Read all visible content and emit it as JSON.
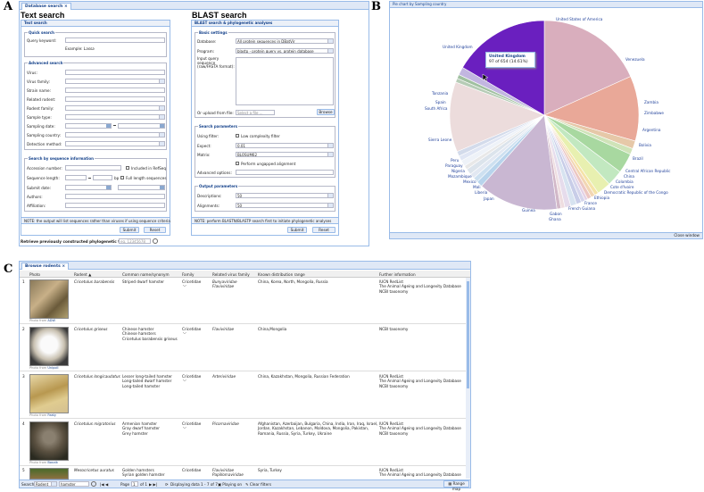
{
  "panel_letters": {
    "a": "A",
    "b": "B",
    "c": "C"
  },
  "panelA": {
    "tab_label": "Database search",
    "text_search": {
      "title": "Text search",
      "subtab": "Text search",
      "quick_legend": "Quick search",
      "query_label": "Query keyword:",
      "example_label": "Example:",
      "example_value": "Lassa",
      "advanced_legend": "Advanced search",
      "fields": [
        "Virus:",
        "Virus family:",
        "Strain name:",
        "Related rodent:",
        "Rodent family:",
        "Sample type:",
        "Sampling date:",
        "Sampling country:",
        "Detection method:"
      ],
      "sequence_legend": "Search by sequence information",
      "accession_label": "Accession number:",
      "refseq_label": "Included in RefSeq",
      "seqlen_label": "Sequence length:",
      "seqlen_unit": "bp",
      "fulllength_label": "Full length sequences",
      "submit_date_label": "Submit date:",
      "authors_label": "Authors:",
      "affiliation_label": "Affiliation:",
      "note": "NOTE: the output will list sequences rather than viruses if using sequence criteria",
      "submit_btn": "Submit",
      "reset_btn": "Reset"
    },
    "retrieve_label": "Retrieve previously constructed phylogenetic tree by ID:",
    "retrieve_value": "eg. 12345678",
    "blast": {
      "title": "BLAST search",
      "subtab": "BLAST search & phylogenetic analyses",
      "basic_legend": "Basic settings",
      "database_label": "Database:",
      "database_value": "All protein sequences in DBatVir",
      "program_label": "Program:",
      "program_value": "blastp - protein query vs. protein database",
      "input_label": "Input query sequence (raw/FASTA format):",
      "upload_label": "Or upload from file:",
      "upload_placeholder": "Select a file ...",
      "browse_btn": "Browse",
      "params_legend": "Search parameters",
      "filter_label": "Using filter:",
      "filter_value": "Low complexity filter",
      "expect_label": "Expect:",
      "expect_value": "0.01",
      "matrix_label": "Matrix:",
      "matrix_value": "BLOSUM62",
      "ungapped_label": "Perform ungapped alignment",
      "advanced_label": "Advanced options:",
      "output_legend": "Output parameters",
      "descriptions_label": "Descriptions:",
      "descriptions_value": "50",
      "alignments_label": "Alignments:",
      "alignments_value": "50",
      "note": "NOTE: perform BLASTN/BLASTP search first to initiate phylogenetic analyses",
      "submit_btn": "Submit",
      "reset_btn": "Reset"
    }
  },
  "panelB": {
    "window_title": "Pie chart by Sampling country",
    "close_btn": "Close window",
    "tooltip_title": "United Kingdom",
    "tooltip_value": "97 of 654 (14.61%)"
  },
  "chart_data": {
    "type": "pie",
    "title": "",
    "total": 654,
    "slices": [
      {
        "label": "United States of America",
        "value": 107,
        "color": "#d9aebd"
      },
      {
        "label": "Venezuela",
        "value": 65,
        "color": "#e9a898"
      },
      {
        "label": "Zambia",
        "value": 8,
        "color": "#e6c8a8"
      },
      {
        "label": "Zimbabwe",
        "value": 6,
        "color": "#cfe3b8"
      },
      {
        "label": "Argentina",
        "value": 20,
        "color": "#a8d8a0"
      },
      {
        "label": "Bolivia",
        "value": 16,
        "color": "#c2e8c0"
      },
      {
        "label": "Brazil",
        "value": 14,
        "color": "#e8f0b0"
      },
      {
        "label": "Central African Republic",
        "value": 4,
        "color": "#f5e3a8"
      },
      {
        "label": "China",
        "value": 4,
        "color": "#f2d6b4"
      },
      {
        "label": "Colombia",
        "value": 4,
        "color": "#ecc7c2"
      },
      {
        "label": "Cote d'Ivoire",
        "value": 3,
        "color": "#e4d2e6"
      },
      {
        "label": "Democratic Republic of the Congo",
        "value": 4,
        "color": "#d5d5ec"
      },
      {
        "label": "Ethiopia",
        "value": 5,
        "color": "#c8cde8"
      },
      {
        "label": "France",
        "value": 6,
        "color": "#d7e3f0"
      },
      {
        "label": "French Guiana",
        "value": 6,
        "color": "#e6dcec"
      },
      {
        "label": "Gabon",
        "value": 4,
        "color": "#eedde0"
      },
      {
        "label": "Ghana",
        "value": 4,
        "color": "#d2b8c8"
      },
      {
        "label": "Guinea",
        "value": 80,
        "color": "#c9b7d2"
      },
      {
        "label": "Japan",
        "value": 6,
        "color": "#b8d4ec"
      },
      {
        "label": "Liberia",
        "value": 5,
        "color": "#cde0f0"
      },
      {
        "label": "Mali",
        "value": 5,
        "color": "#e2e8f2"
      },
      {
        "label": "Mexico",
        "value": 6,
        "color": "#dce4ec"
      },
      {
        "label": "Mozambique",
        "value": 4,
        "color": "#e8e8e8"
      },
      {
        "label": "Nigeria",
        "value": 6,
        "color": "#eef2f8"
      },
      {
        "label": "Paraguay",
        "value": 5,
        "color": "#e0e6f4"
      },
      {
        "label": "Peru",
        "value": 5,
        "color": "#d3dbeb"
      },
      {
        "label": "Sierra Leone",
        "value": 70,
        "color": "#ecdcdc"
      },
      {
        "label": "South Africa",
        "value": 4,
        "color": "#b6ccb6"
      },
      {
        "label": "Spain",
        "value": 4,
        "color": "#a0c0a0"
      },
      {
        "label": "Tanzania",
        "value": 8,
        "color": "#c2b6e0"
      },
      {
        "label": "United Kingdom",
        "value": 97,
        "color": "#6a1fbf"
      }
    ]
  },
  "panelC": {
    "tab_label": "Browse rodents",
    "columns": [
      "Photo",
      "Rodent",
      "Common name/synonym",
      "Family",
      "Related virus family",
      "Known distribution range",
      "Further information"
    ],
    "rows": [
      {
        "num": "1",
        "credit_prefix": "Photo from",
        "credit": "ADW",
        "rodent": "Cricetulus barabensis",
        "common": "Striped dwarf hamster",
        "family": "Cricetidae",
        "virus_family": "Bunyaviridae\nFlaviviridae",
        "range": "China, Korea, North, Mongolia, Russia",
        "info": "IUCN RedList\nThe Animal Ageing and Longevity Database\nNCBI taxonomy"
      },
      {
        "num": "2",
        "credit_prefix": "Photo from",
        "credit": "Unipoll",
        "rodent": "Cricetulus griseus",
        "common": "Chinese hamster\nChinese hamsters\nCricetulus barabensis griseus",
        "family": "Cricetidae",
        "virus_family": "Flaviviridae",
        "range": "China,Mongolia",
        "info": "NCBI taxonomy"
      },
      {
        "num": "3",
        "credit_prefix": "Photo from",
        "credit": "Featy",
        "rodent": "Cricetulus longicaudatus",
        "common": "Lesser long-tailed hamster\nLong-tailed dwarf hamster\nLong-tailed hamster",
        "family": "Cricetidae",
        "virus_family": "Arteriviridae",
        "range": "China, Kazakhstan, Mongolia, Russian Federation",
        "info": "IUCN RedList\nThe Animal Ageing and Longevity Database\nNCBI taxonomy"
      },
      {
        "num": "4",
        "credit_prefix": "Photo from",
        "credit": "Bosnik",
        "rodent": "Cricetulus migratorius",
        "common": "Armenian hamster\nGray dwarf hamster\nGrey hamster",
        "family": "Cricetidae",
        "virus_family": "Picornaviridae",
        "range": "Afghanistan, Azerbaijan, Bulgaria, China, India, Iran, Iraq, Israel,\nJordan, Kazakhstan, Lebanon, Moldova, Mongolia, Pakistan,\nRomania, Russia, Syria, Turkey, Ukraine",
        "info": "IUCN RedList\nThe Animal Ageing and Longevity Database\nNCBI taxonomy"
      },
      {
        "num": "5",
        "credit_prefix": "",
        "credit": "",
        "rodent": "Mesocricetus auratus",
        "common": "Golden hamsters\nSyrian golden hamster",
        "family": "Cricetidae",
        "virus_family": "Flaviviridae\nPapillomaviridae",
        "range": "Syria, Turkey",
        "info": "IUCN RedList\nThe Animal Ageing and Longevity Database"
      }
    ],
    "footer": {
      "search_label": "Search",
      "search_field": "Rodent",
      "search_value": "hamster",
      "page_label": "Page",
      "page_value": "1",
      "page_of": "of 1",
      "display_text": "Displaying data 1 - 7 of 7",
      "playing_label": "Playing on",
      "clear_label": "Clear filters",
      "range_map_label": "Range map"
    }
  }
}
